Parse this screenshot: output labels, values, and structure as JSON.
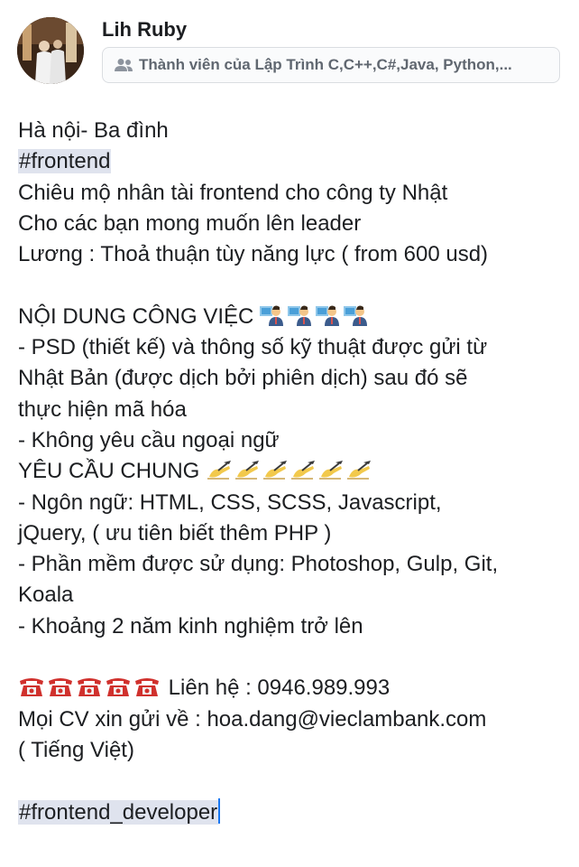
{
  "post": {
    "author_name": "Lih Ruby",
    "group_label": "Thành viên của Lập Trình C,C++,C#,Java, Python,...",
    "lines": {
      "l1": "Hà nội- Ba đình",
      "l2": "#frontend",
      "l3": "Chiêu mộ nhân tài frontend cho công ty Nhật",
      "l4": "Cho các bạn mong muốn lên leader",
      "l5": "Lương : Thoả thuận tùy năng lực ( from 600 usd)",
      "l6": "NỘI DUNG CÔNG VIỆC",
      "l7": "- PSD (thiết kế) và thông số kỹ thuật được gửi từ",
      "l8": "Nhật Bản (được dịch bởi phiên dịch) sau đó sẽ",
      "l9": "thực hiện mã hóa",
      "l10": "- Không yêu cầu ngoại ngữ",
      "l11": "YÊU CẦU CHUNG",
      "l12": "- Ngôn ngữ: HTML, CSS, SCSS, Javascript,",
      "l13": "jQuery, ( ưu tiên  biết thêm PHP )",
      "l14": "- Phần mềm được sử dụng: Photoshop, Gulp, Git,",
      "l15": "Koala",
      "l16": "- Khoảng 2 năm kinh nghiệm trở lên",
      "l17": " Liên hệ : 0946.989.993",
      "l18": "Mọi CV xin gửi về : hoa.dang@vieclambank.com",
      "l19": "( Tiếng Việt)",
      "l20": "#frontend_developer"
    },
    "emoji": {
      "office_worker_count": 4,
      "writing_hand_count": 6,
      "telephone_count": 5
    }
  }
}
